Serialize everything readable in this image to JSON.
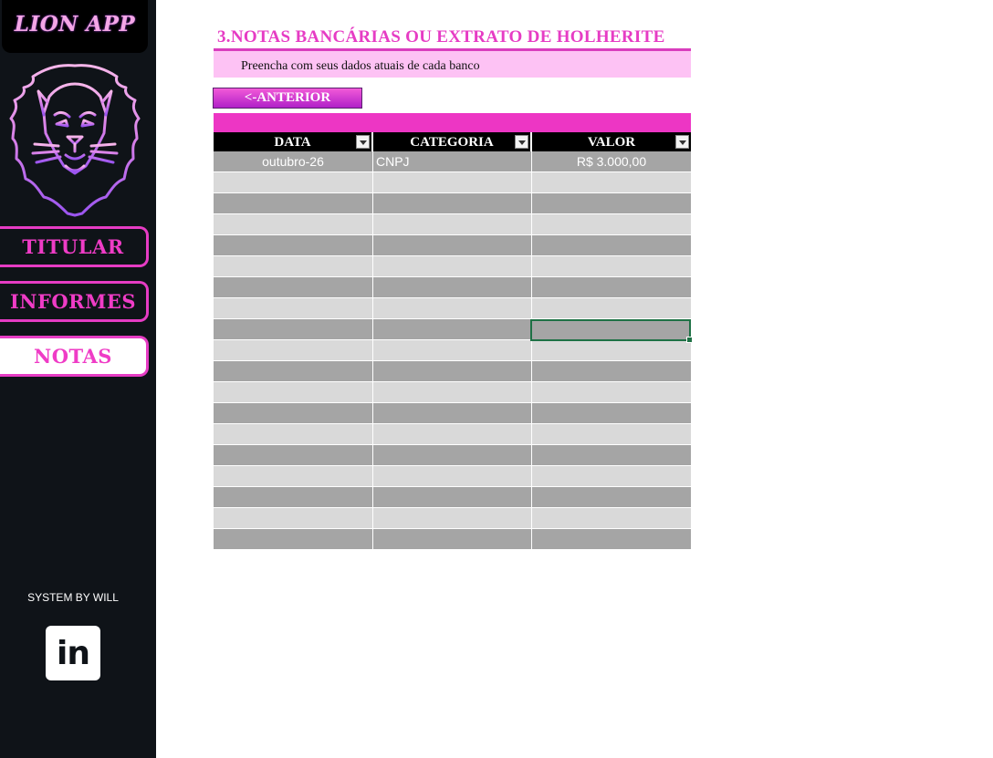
{
  "sidebar": {
    "app_title": "LION APP",
    "logo_icon": "lion-head-icon",
    "nav": [
      {
        "label": "TITULAR",
        "active": false
      },
      {
        "label": "INFORMES",
        "active": false
      },
      {
        "label": "NOTAS",
        "active": true
      }
    ],
    "credit": "SYSTEM BY WILL",
    "social_icon": "linkedin-icon",
    "social_text": "in"
  },
  "main": {
    "title": "3.NOTAS BANCÁRIAS OU EXTRATO DE HOLHERITE",
    "subtitle": "Preencha com seus dados atuais de cada banco",
    "back_button": "<-ANTERIOR",
    "table": {
      "headers": [
        "DATA",
        "CATEGORIA",
        "VALOR"
      ],
      "rows": [
        [
          "outubro-26",
          "CNPJ",
          "R$ 3.000,00"
        ],
        [
          "",
          "",
          ""
        ],
        [
          "",
          "",
          ""
        ],
        [
          "",
          "",
          ""
        ],
        [
          "",
          "",
          ""
        ],
        [
          "",
          "",
          ""
        ],
        [
          "",
          "",
          ""
        ],
        [
          "",
          "",
          ""
        ],
        [
          "",
          "",
          ""
        ],
        [
          "",
          "",
          ""
        ],
        [
          "",
          "",
          ""
        ],
        [
          "",
          "",
          ""
        ],
        [
          "",
          "",
          ""
        ],
        [
          "",
          "",
          ""
        ],
        [
          "",
          "",
          ""
        ],
        [
          "",
          "",
          ""
        ],
        [
          "",
          "",
          ""
        ],
        [
          "",
          "",
          ""
        ],
        [
          "",
          "",
          ""
        ]
      ]
    }
  },
  "colors": {
    "accent": "#e63cc4",
    "sidebar_bg": "#0f1318",
    "band_pink": "#fdc2f4",
    "row_dark": "#a5a5a5",
    "row_light": "#d9d9d9",
    "selection": "#1e7145"
  }
}
